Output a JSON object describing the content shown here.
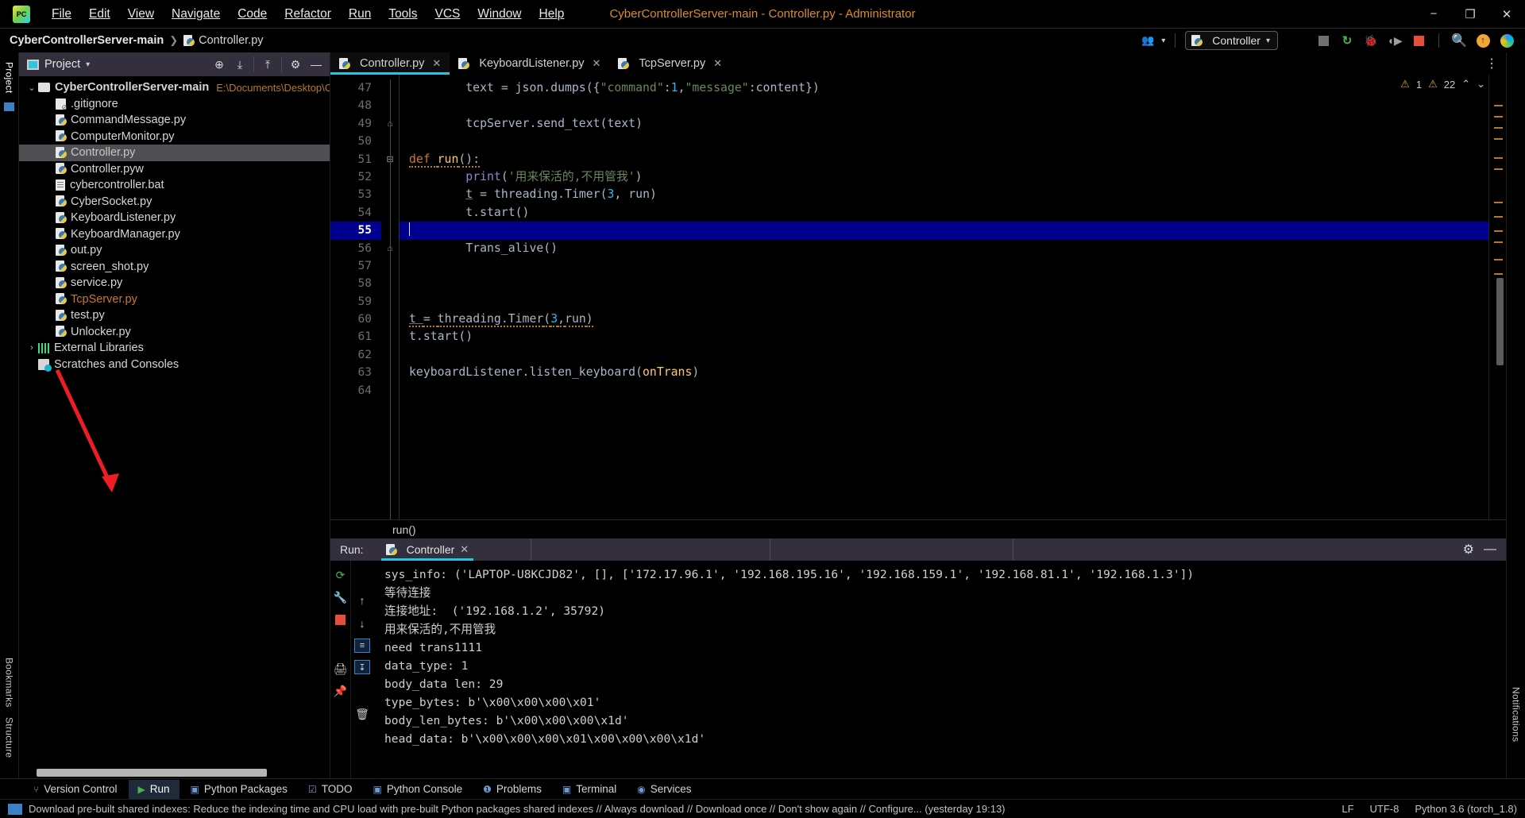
{
  "window": {
    "title": "CyberControllerServer-main - Controller.py - Administrator",
    "logo": "pycharm-logo-icon",
    "minimize": "−",
    "maximize": "❐",
    "close": "✕"
  },
  "menubar": {
    "items": [
      {
        "label": "File"
      },
      {
        "label": "Edit"
      },
      {
        "label": "View"
      },
      {
        "label": "Navigate"
      },
      {
        "label": "Code"
      },
      {
        "label": "Refactor"
      },
      {
        "label": "Run"
      },
      {
        "label": "Tools"
      },
      {
        "label": "VCS"
      },
      {
        "label": "Window"
      },
      {
        "label": "Help"
      }
    ]
  },
  "breadcrumb": {
    "project": "CyberControllerServer-main",
    "separator": "❯",
    "file": "Controller.py"
  },
  "toolbar": {
    "account_icon": "user-account-icon",
    "account_caret": "▾",
    "run_config": "Controller",
    "run_config_caret": "▾",
    "icons": [
      {
        "name": "stop-gray-icon",
        "glyph": "■"
      },
      {
        "name": "run-icon",
        "glyph": "⟳"
      },
      {
        "name": "debug-icon",
        "glyph": "🐞"
      },
      {
        "name": "run-with-coverage-icon",
        "glyph": "▶"
      },
      {
        "name": "stop-red-icon",
        "glyph": "■"
      },
      {
        "name": "search-icon",
        "glyph": "🔍"
      },
      {
        "name": "update-icon",
        "glyph": "↑"
      },
      {
        "name": "ide-feature-icon",
        "glyph": "◐"
      }
    ],
    "kebab": "⋮"
  },
  "left_rail": {
    "tabs": [
      "Project"
    ],
    "bookmarks": "Bookmarks",
    "structure": "Structure"
  },
  "right_rail": {
    "notifications": "Notifications"
  },
  "project_panel": {
    "title": "Project",
    "title_caret": "▾",
    "header_icons": [
      {
        "name": "select-opened-file-icon",
        "glyph": "⊕"
      },
      {
        "name": "expand-all-icon",
        "glyph": "⤓"
      },
      {
        "name": "collapse-all-icon",
        "glyph": "⤒"
      },
      {
        "name": "settings-gear-icon",
        "glyph": "⚙"
      },
      {
        "name": "hide-panel-icon",
        "glyph": "—"
      }
    ],
    "root": {
      "label": "CyberControllerServer-main",
      "path": "E:\\Documents\\Desktop\\Cybe",
      "twisty": "⌄"
    },
    "files": [
      {
        "label": ".gitignore",
        "icon": "gitignore-file-icon",
        "selected": false
      },
      {
        "label": "CommandMessage.py",
        "icon": "python-file-icon",
        "selected": false
      },
      {
        "label": "ComputerMonitor.py",
        "icon": "python-file-icon",
        "selected": false
      },
      {
        "label": "Controller.py",
        "icon": "python-file-icon",
        "selected": true
      },
      {
        "label": "Controller.pyw",
        "icon": "python-file-icon",
        "selected": false
      },
      {
        "label": "cybercontroller.bat",
        "icon": "bat-file-icon",
        "selected": false
      },
      {
        "label": "CyberSocket.py",
        "icon": "python-file-icon",
        "selected": false
      },
      {
        "label": "KeyboardListener.py",
        "icon": "python-file-icon",
        "selected": false
      },
      {
        "label": "KeyboardManager.py",
        "icon": "python-file-icon",
        "selected": false
      },
      {
        "label": "out.py",
        "icon": "python-file-icon",
        "selected": false
      },
      {
        "label": "screen_shot.py",
        "icon": "python-file-icon",
        "selected": false
      },
      {
        "label": "service.py",
        "icon": "python-file-icon",
        "selected": false
      },
      {
        "label": "TcpServer.py",
        "icon": "python-file-icon",
        "selected": false,
        "orange": true
      },
      {
        "label": "test.py",
        "icon": "python-file-icon",
        "selected": false
      },
      {
        "label": "Unlocker.py",
        "icon": "python-file-icon",
        "selected": false
      }
    ],
    "external_libraries": {
      "label": "External Libraries",
      "twisty": "›"
    },
    "scratches": {
      "label": "Scratches and Consoles"
    }
  },
  "editor": {
    "tabs": [
      {
        "label": "Controller.py",
        "active": true,
        "close": "✕"
      },
      {
        "label": "KeyboardListener.py",
        "active": false,
        "close": "✕"
      },
      {
        "label": "TcpServer.py",
        "active": false,
        "close": "✕"
      }
    ],
    "kebab": "⋮",
    "warnings": {
      "error_icon": "⚠",
      "error_count": "1",
      "warn_icon": "⚠",
      "warn_count": "22",
      "up": "⌃",
      "down": "⌄"
    },
    "first_line_number": 47,
    "current_line": 55,
    "lines": [
      {
        "n": 47,
        "text": "        text = json.dumps({\"command\":1,\"message\":content})"
      },
      {
        "n": 48,
        "text": ""
      },
      {
        "n": 49,
        "text": "        tcpServer.send_text(text)",
        "fold": "⊟"
      },
      {
        "n": 50,
        "text": ""
      },
      {
        "n": 51,
        "text": "def run():",
        "fold": "⊟"
      },
      {
        "n": 52,
        "text": "        print('用来保活的,不用管我')"
      },
      {
        "n": 53,
        "text": "        t = threading.Timer(3, run)"
      },
      {
        "n": 54,
        "text": "        t.start()"
      },
      {
        "n": 55,
        "text": "",
        "current": true
      },
      {
        "n": 56,
        "text": "        Trans_alive()",
        "fold": "⊟"
      },
      {
        "n": 57,
        "text": ""
      },
      {
        "n": 58,
        "text": ""
      },
      {
        "n": 59,
        "text": ""
      },
      {
        "n": 60,
        "text": "t = threading.Timer(3,run)"
      },
      {
        "n": 61,
        "text": "t.start()"
      },
      {
        "n": 62,
        "text": ""
      },
      {
        "n": 63,
        "text": "keyboardListener.listen_keyboard(onTrans)"
      },
      {
        "n": 64,
        "text": ""
      }
    ],
    "bottom_breadcrumb": "run()"
  },
  "run_panel": {
    "label": "Run:",
    "tab": "Controller",
    "tab_close": "✕",
    "settings_icon": "⚙",
    "minimize_icon": "—",
    "rail_icons": [
      {
        "name": "rerun-icon",
        "glyph": "⟳"
      },
      {
        "name": "scroll-up-icon",
        "glyph": "↑"
      },
      {
        "name": "wrench-settings-icon",
        "glyph": "🔧"
      },
      {
        "name": "scroll-down-icon",
        "glyph": "↓"
      },
      {
        "name": "stop-icon",
        "glyph": "■"
      },
      {
        "name": "print-icon",
        "glyph": "🖨"
      },
      {
        "name": "trash-icon",
        "glyph": "🗑"
      },
      {
        "name": "pin-icon",
        "glyph": "📌"
      }
    ],
    "console_lines": [
      "sys_info: ('LAPTOP-U8KCJD82', [], ['172.17.96.1', '192.168.195.16', '192.168.159.1', '192.168.81.1', '192.168.1.3'])",
      "等待连接",
      "连接地址:  ('192.168.1.2', 35792)",
      "用来保活的,不用管我",
      "need trans1111",
      "data_type: 1",
      "body_data len: 29",
      "type_bytes: b'\\x00\\x00\\x00\\x01'",
      "body_len_bytes: b'\\x00\\x00\\x00\\x1d'",
      "head_data: b'\\x00\\x00\\x00\\x01\\x00\\x00\\x00\\x1d'"
    ]
  },
  "bottom_tabs": [
    {
      "label": "Version Control",
      "icon": "version-control-icon",
      "glyph": "⑂",
      "active": false
    },
    {
      "label": "Run",
      "icon": "run-icon",
      "glyph": "▶",
      "active": true
    },
    {
      "label": "Python Packages",
      "icon": "python-packages-icon",
      "glyph": "▣",
      "active": false
    },
    {
      "label": "TODO",
      "icon": "todo-icon",
      "glyph": "☑",
      "active": false
    },
    {
      "label": "Python Console",
      "icon": "python-console-icon",
      "glyph": "▣",
      "active": false
    },
    {
      "label": "Problems",
      "icon": "problems-icon",
      "glyph": "❶",
      "active": false
    },
    {
      "label": "Terminal",
      "icon": "terminal-icon",
      "glyph": "▣",
      "active": false
    },
    {
      "label": "Services",
      "icon": "services-icon",
      "glyph": "◉",
      "active": false
    }
  ],
  "statusbar": {
    "icon": "indexing-icon",
    "message": "Download pre-built shared indexes: Reduce the indexing time and CPU load with pre-built Python packages shared indexes // Always download // Download once // Don't show again // Configure... (yesterday 19:13)",
    "line_sep": "LF",
    "encoding": "UTF-8",
    "interpreter": "Python 3.6 (torch_1.8)"
  },
  "annotation": {
    "type": "red-arrow",
    "color": "#ee1c25"
  }
}
